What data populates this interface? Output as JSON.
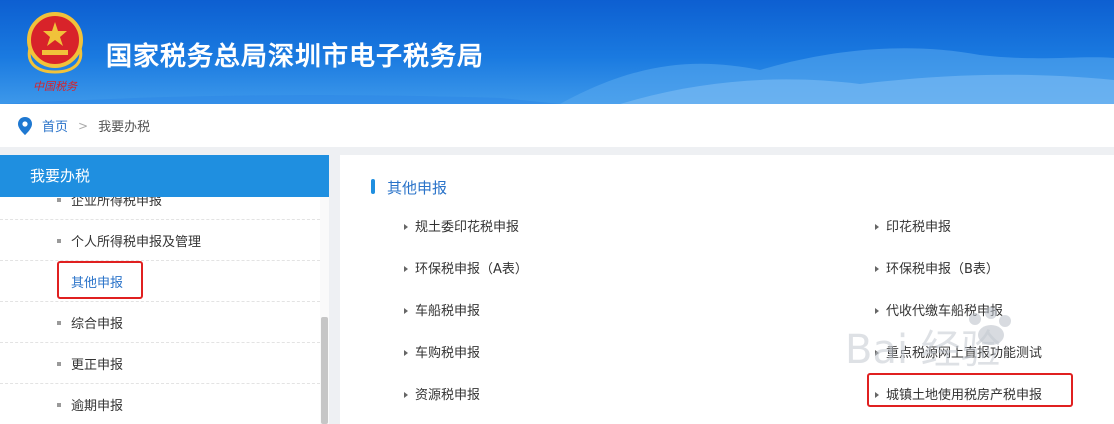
{
  "header": {
    "site_title": "国家税务总局深圳市电子税务局",
    "emblem_caption": "中国税务"
  },
  "breadcrumb": {
    "home": "首页",
    "separator": ">",
    "current": "我要办税"
  },
  "sidebar": {
    "title": "我要办税",
    "items": [
      {
        "label": "企业所得税申报"
      },
      {
        "label": "个人所得税申报及管理"
      },
      {
        "label": "其他申报",
        "active": true
      },
      {
        "label": "综合申报"
      },
      {
        "label": "更正申报"
      },
      {
        "label": "逾期申报"
      }
    ]
  },
  "main": {
    "section_title": "其他申报",
    "left_links": [
      {
        "label": "规土委印花税申报"
      },
      {
        "label": "环保税申报（A表）"
      },
      {
        "label": "车船税申报"
      },
      {
        "label": "车购税申报"
      },
      {
        "label": "资源税申报"
      }
    ],
    "right_links": [
      {
        "label": "印花税申报"
      },
      {
        "label": "环保税申报（B表）"
      },
      {
        "label": "代收代缴车船税申报"
      },
      {
        "label": "重点税源网上直报功能测试"
      },
      {
        "label": "城镇土地使用税房产税申报"
      }
    ]
  },
  "watermark": {
    "text": "Bai 经验"
  },
  "colors": {
    "header_blue": "#1a7ae0",
    "accent_blue": "#1f8fe0",
    "link_blue": "#2a73c9",
    "highlight_red": "#e02020"
  }
}
